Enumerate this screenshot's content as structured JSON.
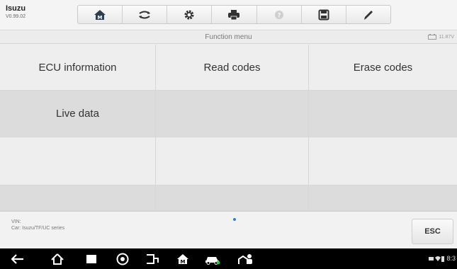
{
  "header": {
    "brand_name": "Isuzu",
    "version": "V0.99.02",
    "toolbar": [
      {
        "icon": "home-icon"
      },
      {
        "icon": "vehicle-swap-icon"
      },
      {
        "icon": "gear-icon"
      },
      {
        "icon": "printer-icon"
      },
      {
        "icon": "help-icon"
      },
      {
        "icon": "save-icon"
      },
      {
        "icon": "pen-icon"
      }
    ]
  },
  "subheader": {
    "title": "Function menu",
    "battery_voltage": "11.87V"
  },
  "functions": {
    "ecu_information": "ECU information",
    "read_codes": "Read codes",
    "erase_codes": "Erase codes",
    "live_data": "Live data"
  },
  "footer": {
    "vin_label": "VIN:",
    "car_info": "Car: Isuzu/TF/UC series",
    "esc_label": "ESC"
  },
  "system_bar": {
    "time": "8:3",
    "icons": [
      "back-icon",
      "home-icon",
      "recent-apps-icon",
      "browser-icon",
      "vci-icon",
      "maxisys-home-icon",
      "car-icon",
      "workshop-icon"
    ]
  },
  "colors": {
    "accent": "#2a7fd4",
    "grid_light": "#eeeeee",
    "grid_dark": "#dcdcdc"
  }
}
